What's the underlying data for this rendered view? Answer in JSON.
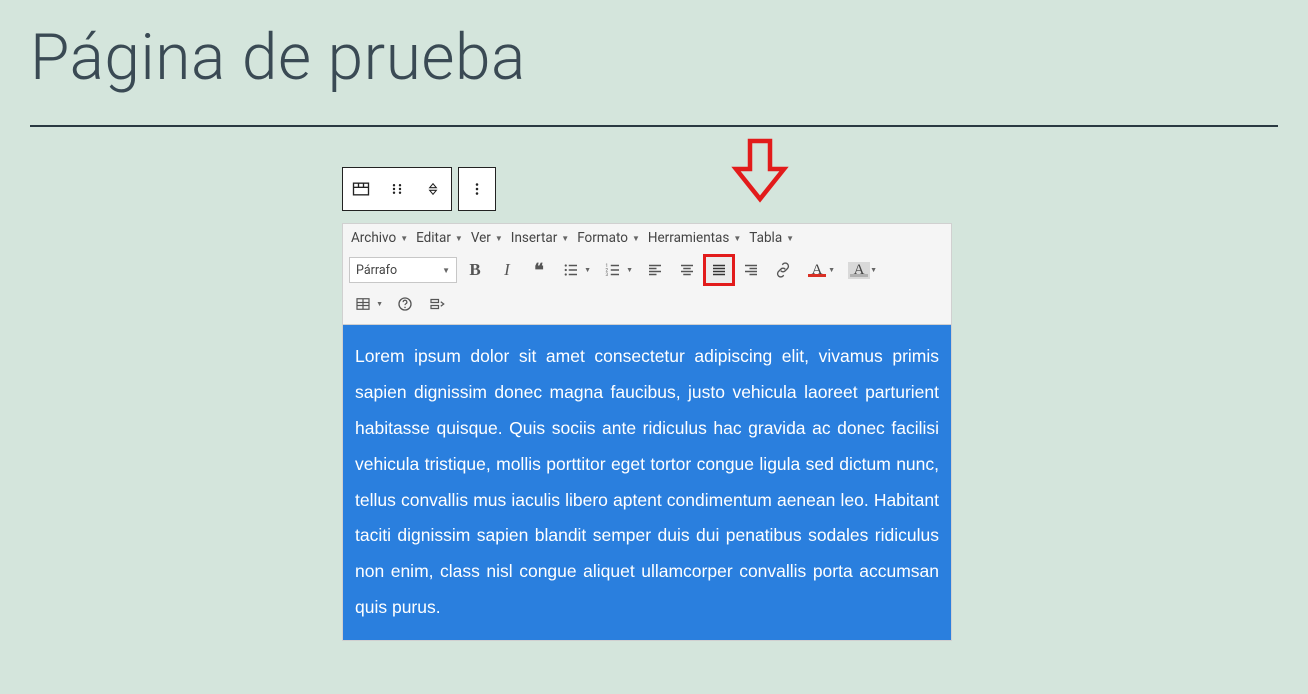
{
  "page": {
    "title": "Página de prueba"
  },
  "block_toolbar": {
    "icons": [
      "classic-block",
      "drag-handle",
      "move",
      "more"
    ]
  },
  "menubar": {
    "items": [
      "Archivo",
      "Editar",
      "Ver",
      "Insertar",
      "Formato",
      "Herramientas",
      "Tabla"
    ]
  },
  "format_select": {
    "value": "Párrafo"
  },
  "toolbar_row1": [
    {
      "name": "bold",
      "label": "B"
    },
    {
      "name": "italic",
      "label": "I"
    },
    {
      "name": "blockquote",
      "label": "❝"
    },
    {
      "name": "bulleted-list",
      "caret": true
    },
    {
      "name": "numbered-list",
      "caret": true
    },
    {
      "name": "align-left"
    },
    {
      "name": "align-center"
    },
    {
      "name": "align-justify",
      "highlight": true
    },
    {
      "name": "align-right"
    },
    {
      "name": "link"
    },
    {
      "name": "text-color",
      "caret": true,
      "bar": "#d93025"
    },
    {
      "name": "background-color",
      "caret": true,
      "bar": "#b0b0b0"
    }
  ],
  "toolbar_row2": [
    {
      "name": "table",
      "caret": true
    },
    {
      "name": "help"
    },
    {
      "name": "distraction-free"
    }
  ],
  "content": {
    "text": "Lorem ipsum dolor sit amet consectetur adipiscing elit, vivamus primis sapien dignissim donec magna faucibus, justo vehicula laoreet parturient habitasse quisque. Quis sociis ante ridiculus hac gravida ac donec facilisi vehicula tristique, mollis porttitor eget tortor congue ligula sed dictum nunc, tellus convallis mus iaculis libero aptent condimentum aenean leo. Habitant taciti dignissim sapien blandit semper duis dui penatibus sodales ridiculus non enim, class nisl congue aliquet ullamcorper convallis porta accumsan quis purus."
  },
  "annotation": {
    "type": "arrow-down",
    "color": "#e21b1b"
  }
}
